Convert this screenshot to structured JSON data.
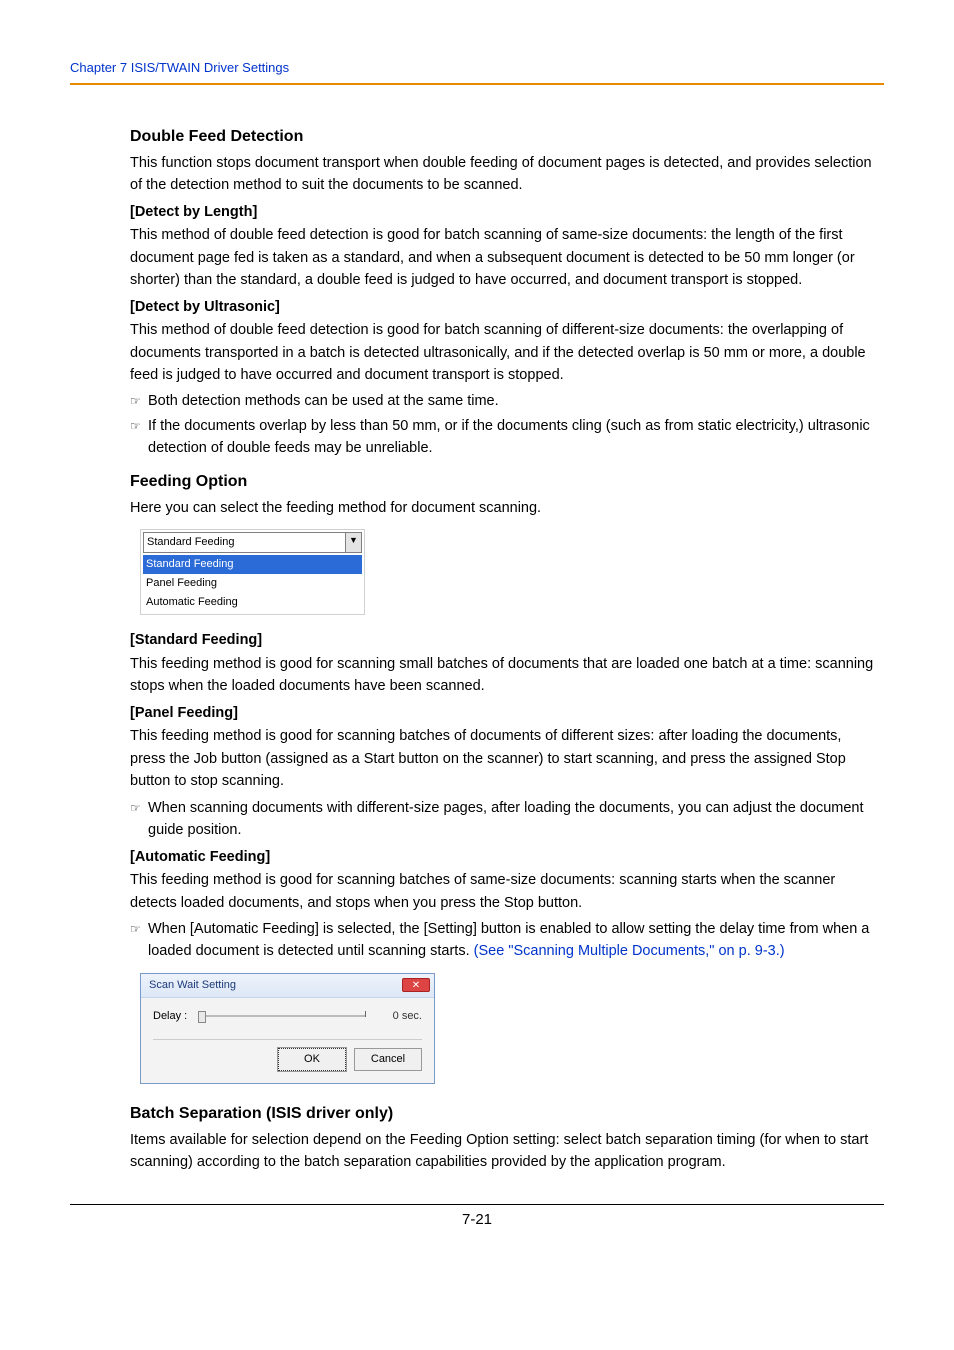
{
  "header": {
    "chapter": "Chapter 7   ISIS/TWAIN Driver Settings"
  },
  "sections": {
    "dfd": {
      "title": "Double Feed Detection",
      "intro": "This function stops document transport when double feeding of document pages is detected, and provides selection of the detection method to suit the documents to be scanned.",
      "byLengthTitle": "[Detect by Length]",
      "byLengthText": "This method of double feed detection is good for batch scanning of same-size documents: the length of the first document page fed is taken as a standard, and when a subsequent document is detected to be 50 mm longer (or shorter) than the standard, a double feed is judged to have occurred, and document transport is stopped.",
      "byUltraTitle": "[Detect by Ultrasonic]",
      "byUltraText": "This method of double feed detection is good for batch scanning of different-size documents: the overlapping of documents transported in a batch is detected ultrasonically, and if the detected overlap is 50 mm or more, a double feed is judged to have occurred and document transport is stopped.",
      "note1": "Both detection methods can be used at the same time.",
      "note2": "If the documents overlap by less than 50 mm, or if the documents cling (such as from static electricity,) ultrasonic detection of double feeds may be unreliable."
    },
    "feed": {
      "title": "Feeding Option",
      "intro": "Here you can select the feeding method for document scanning.",
      "dropdown": {
        "selected": "Standard Feeding",
        "items": [
          "Standard Feeding",
          "Panel Feeding",
          "Automatic Feeding"
        ]
      },
      "stdTitle": "[Standard Feeding]",
      "stdText": "This feeding method is good for scanning small batches of documents that are loaded one batch at a time: scanning stops when the loaded documents have been scanned.",
      "panelTitle": "[Panel Feeding]",
      "panelText": "This feeding method is good for scanning batches of documents of different sizes: after loading the documents, press the Job button (assigned as a Start button on the scanner) to start scanning, and press the assigned Stop button to stop scanning.",
      "panelNote": "When scanning documents with different-size pages, after loading the documents, you can adjust the document guide position.",
      "autoTitle": "[Automatic Feeding]",
      "autoText": "This feeding method is good for scanning batches of same-size documents: scanning starts when the scanner detects loaded documents, and stops when you press the Stop button.",
      "autoNoteA": "When [Automatic Feeding] is selected, the [Setting] button is enabled to allow setting the delay time from when a loaded document is detected until scanning starts. ",
      "autoNoteLink": "(See \"Scanning Multiple Documents,\" on p. 9-3.)"
    },
    "dialog": {
      "title": "Scan Wait Setting",
      "delayLabel": "Delay :",
      "delayValue": "0 sec.",
      "ok": "OK",
      "cancel": "Cancel"
    },
    "batch": {
      "title": " Batch Separation (ISIS driver only)",
      "text": "Items available for selection depend on the Feeding Option setting: select batch separation timing (for when to start scanning) according to the batch separation capabilities provided by the application program."
    }
  },
  "pageNumber": "7-21",
  "icons": {
    "note": "☞"
  }
}
